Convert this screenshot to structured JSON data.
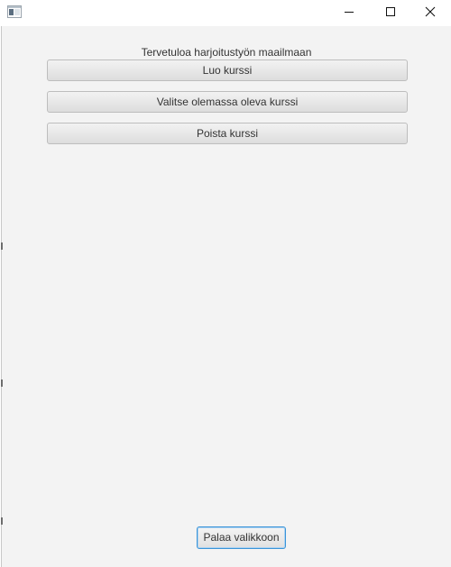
{
  "window": {
    "icons": {
      "app": "app-window-icon",
      "minimize": "minimize-icon",
      "maximize": "maximize-icon",
      "close": "close-icon"
    }
  },
  "main": {
    "welcome_text": "Tervetuloa harjoitustyön maailmaan",
    "buttons": {
      "create_course": "Luo kurssi",
      "select_course": "Valitse olemassa oleva kurssi",
      "delete_course": "Poista kurssi"
    },
    "back_button": "Palaa valikkoon"
  },
  "colors": {
    "background": "#f3f3f3",
    "focus_border": "#3a94d8"
  }
}
